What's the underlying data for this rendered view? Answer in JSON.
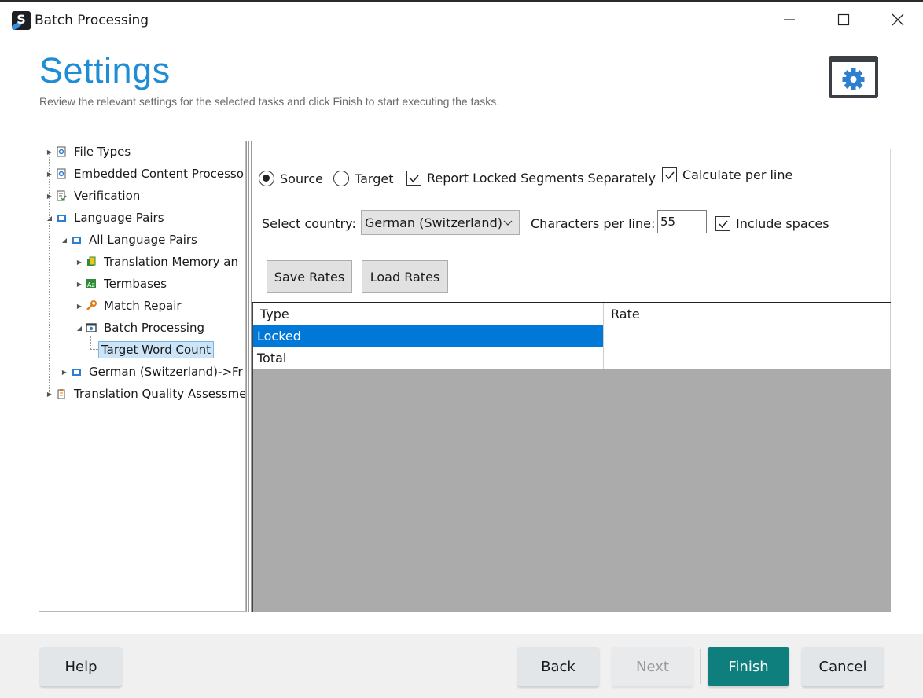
{
  "window": {
    "title": "Batch Processing",
    "app_icon_letter": "S",
    "controls": [
      "minimize-icon",
      "maximize-icon",
      "close-icon"
    ]
  },
  "header": {
    "title": "Settings",
    "subtitle": "Review the relevant settings for the selected tasks and click Finish to start executing the tasks.",
    "icon": "settings-gear-icon"
  },
  "tree": {
    "items": [
      {
        "label": "File Types",
        "icon": "file-types-icon"
      },
      {
        "label": "Embedded Content Processo",
        "icon": "embedded-content-icon"
      },
      {
        "label": "Verification",
        "icon": "verification-icon"
      },
      {
        "label": "Language Pairs",
        "icon": "language-pairs-icon"
      },
      {
        "label": "All Language Pairs",
        "icon": "language-pair-icon"
      },
      {
        "label": "Translation Memory an",
        "icon": "translation-memory-icon"
      },
      {
        "label": "Termbases",
        "icon": "termbase-icon"
      },
      {
        "label": "Match Repair",
        "icon": "wrench-icon"
      },
      {
        "label": "Batch Processing",
        "icon": "batch-processing-icon"
      },
      {
        "label": "Target Word Count",
        "icon": ""
      },
      {
        "label": "German (Switzerland)->Fr",
        "icon": "language-pair-icon"
      },
      {
        "label": "Translation Quality Assessme",
        "icon": "quality-assessment-icon"
      }
    ],
    "selected": "Target Word Count"
  },
  "options": {
    "source_label": "Source",
    "target_label": "Target",
    "selected_radio": "Source",
    "report_locked_label": "Report Locked Segments Separately",
    "report_locked_checked": true,
    "calculate_per_line_label": "Calculate per line",
    "calculate_per_line_checked": true,
    "select_country_label": "Select country:",
    "country_value": "German (Switzerland)",
    "chars_per_line_label": "Characters per line:",
    "chars_per_line_value": "55",
    "include_spaces_label": "Include spaces",
    "include_spaces_checked": true,
    "save_rates_label": "Save Rates",
    "load_rates_label": "Load Rates"
  },
  "grid": {
    "columns": [
      "Type",
      "Rate"
    ],
    "rows": [
      {
        "type": "Locked",
        "rate": ""
      },
      {
        "type": "Total",
        "rate": ""
      }
    ],
    "selected_row": "Locked"
  },
  "footer": {
    "help_label": "Help",
    "back_label": "Back",
    "next_label": "Next",
    "finish_label": "Finish",
    "cancel_label": "Cancel"
  },
  "colors": {
    "title_blue": "#1f8dd6",
    "selection_blue": "#0078d7",
    "finish_teal": "#0e7f7c",
    "grid_background": "#ababab"
  }
}
